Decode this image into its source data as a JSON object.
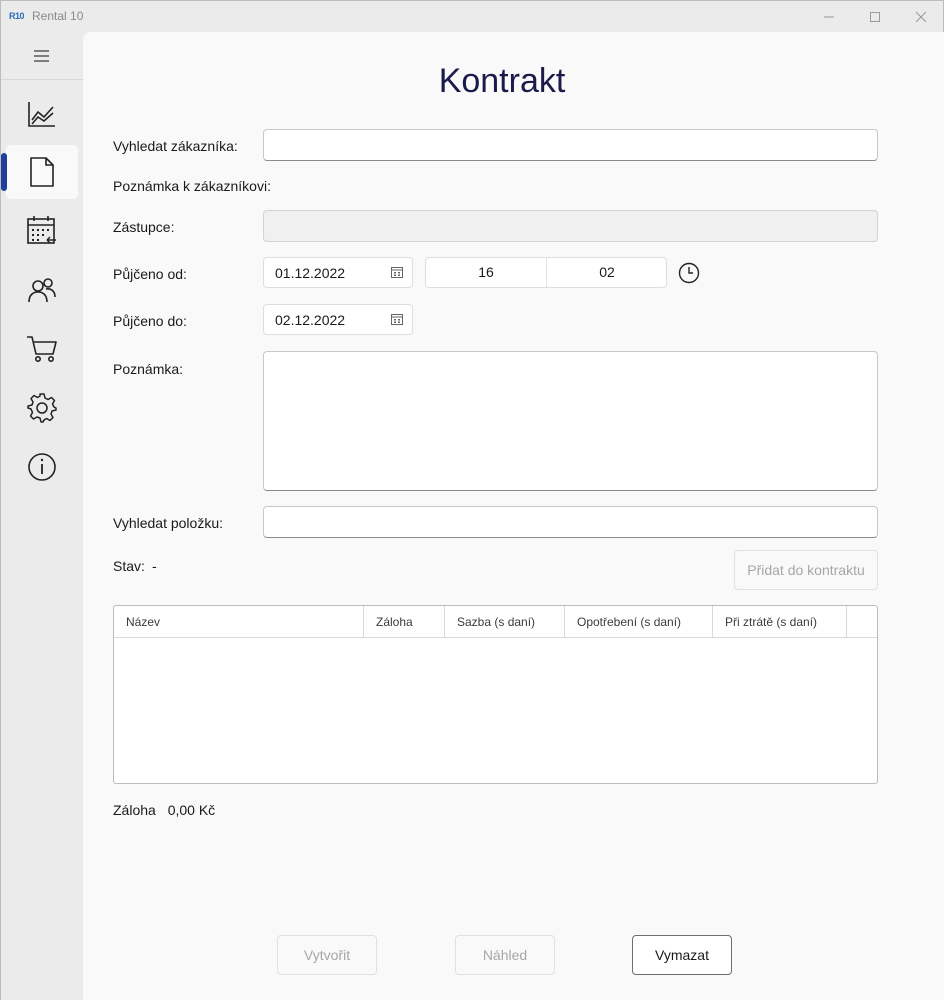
{
  "window": {
    "logo": "R10",
    "title": "Rental 10"
  },
  "sidebar": {
    "items": [
      {
        "icon": "chart-icon",
        "name": "sidebar-item-chart"
      },
      {
        "icon": "document-icon",
        "name": "sidebar-item-contract",
        "active": true
      },
      {
        "icon": "calendar-icon",
        "name": "sidebar-item-calendar"
      },
      {
        "icon": "users-icon",
        "name": "sidebar-item-customers"
      },
      {
        "icon": "cart-icon",
        "name": "sidebar-item-cart"
      },
      {
        "icon": "gear-icon",
        "name": "sidebar-item-settings"
      },
      {
        "icon": "info-icon",
        "name": "sidebar-item-info"
      }
    ],
    "accent": "#1f3f9e"
  },
  "form": {
    "title": "Kontrakt",
    "customer_search_label": "Vyhledat zákazníka:",
    "customer_search_value": "",
    "customer_note_label": "Poznámka k zákazníkovi:",
    "representative_label": "Zástupce:",
    "representative_value": "",
    "borrowed_from_label": "Půjčeno od:",
    "borrowed_from_date": "01.12.2022",
    "borrowed_from_hour": "16",
    "borrowed_from_minute": "02",
    "borrowed_to_label": "Půjčeno do:",
    "borrowed_to_date": "02.12.2022",
    "note_label": "Poznámka:",
    "note_value": "",
    "item_search_label": "Vyhledat položku:",
    "item_search_value": "",
    "status_label": "Stav:",
    "status_value": "-",
    "add_button": "Přidat do kontraktu"
  },
  "table": {
    "columns": [
      "Název",
      "Záloha",
      "Sazba (s daní)",
      "Opotřebení (s daní)",
      "Při ztrátě (s daní)"
    ],
    "rows": []
  },
  "summary": {
    "deposit_label": "Záloha",
    "deposit_value": "0,00 Kč"
  },
  "actions": {
    "create": "Vytvořit",
    "preview": "Náhled",
    "clear": "Vymazat"
  }
}
